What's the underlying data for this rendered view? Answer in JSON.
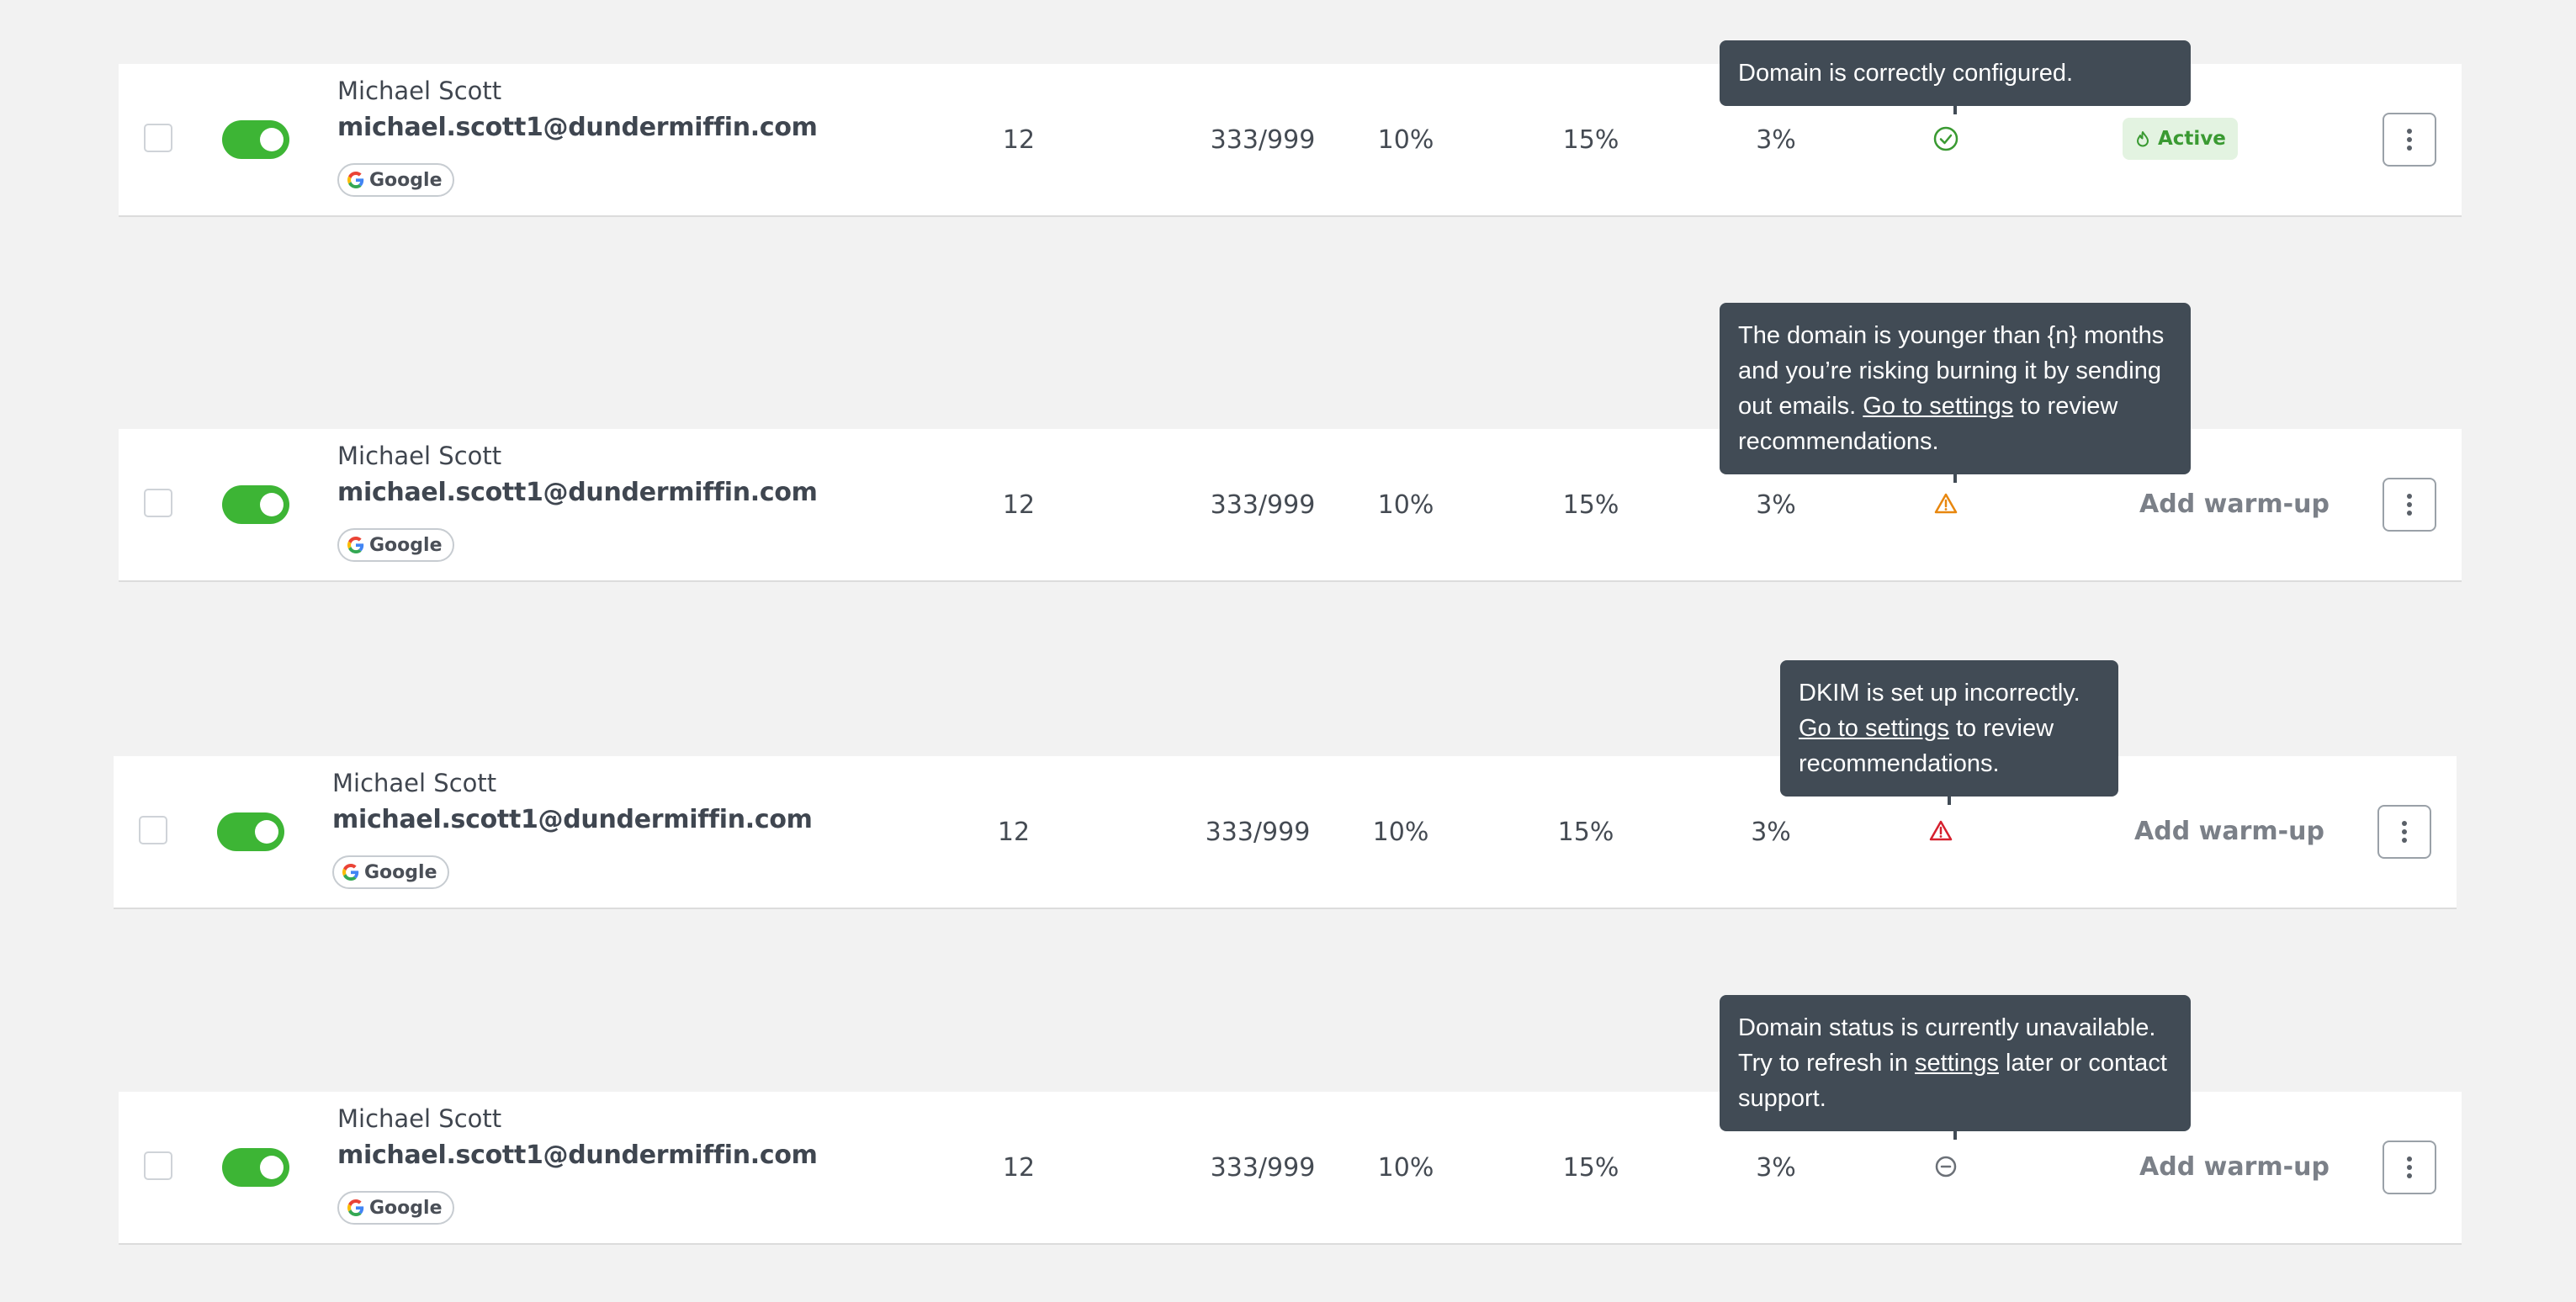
{
  "rows": [
    {
      "name": "Michael Scott",
      "email": "michael.scott1@dundermiffin.com",
      "provider": "Google",
      "count": "12",
      "ratio": "333/999",
      "p1": "10%",
      "p2": "15%",
      "p3": "3%",
      "status_icon": "check-circle-icon",
      "action": "Active",
      "tooltip": {
        "text_before": "Domain is correctly configured.",
        "link": "",
        "text_after": ""
      }
    },
    {
      "name": "Michael Scott",
      "email": "michael.scott1@dundermiffin.com",
      "provider": "Google",
      "count": "12",
      "ratio": "333/999",
      "p1": "10%",
      "p2": "15%",
      "p3": "3%",
      "status_icon": "warning-triangle-icon",
      "action": "Add warm-up",
      "tooltip": {
        "text_before": "The domain is younger than {n} months and you’re risking burning it by sending out emails. ",
        "link": "Go to settings",
        "text_after": " to review recommendations."
      }
    },
    {
      "name": "Michael Scott",
      "email": "michael.scott1@dundermiffin.com",
      "provider": "Google",
      "count": "12",
      "ratio": "333/999",
      "p1": "10%",
      "p2": "15%",
      "p3": "3%",
      "status_icon": "error-triangle-icon",
      "action": "Add warm-up",
      "tooltip": {
        "text_before": "DKIM is set up incorrectly. ",
        "link": "Go to settings",
        "text_after": " to review recommendations."
      }
    },
    {
      "name": "Michael Scott",
      "email": "michael.scott1@dundermiffin.com",
      "provider": "Google",
      "count": "12",
      "ratio": "333/999",
      "p1": "10%",
      "p2": "15%",
      "p3": "3%",
      "status_icon": "unavailable-circle-icon",
      "action": "Add warm-up",
      "tooltip": {
        "text_before": "Domain status is currently unavailable. Try to refresh in ",
        "link": "settings",
        "text_after": " later or contact support."
      }
    }
  ],
  "colors": {
    "toggle_on": "#3db535",
    "active_badge_bg": "#e3f3e1",
    "active_badge_text": "#3a9a32",
    "warning": "#e8870e",
    "error": "#d6202e",
    "ok": "#3a9a32",
    "tooltip_bg": "#414b55"
  }
}
